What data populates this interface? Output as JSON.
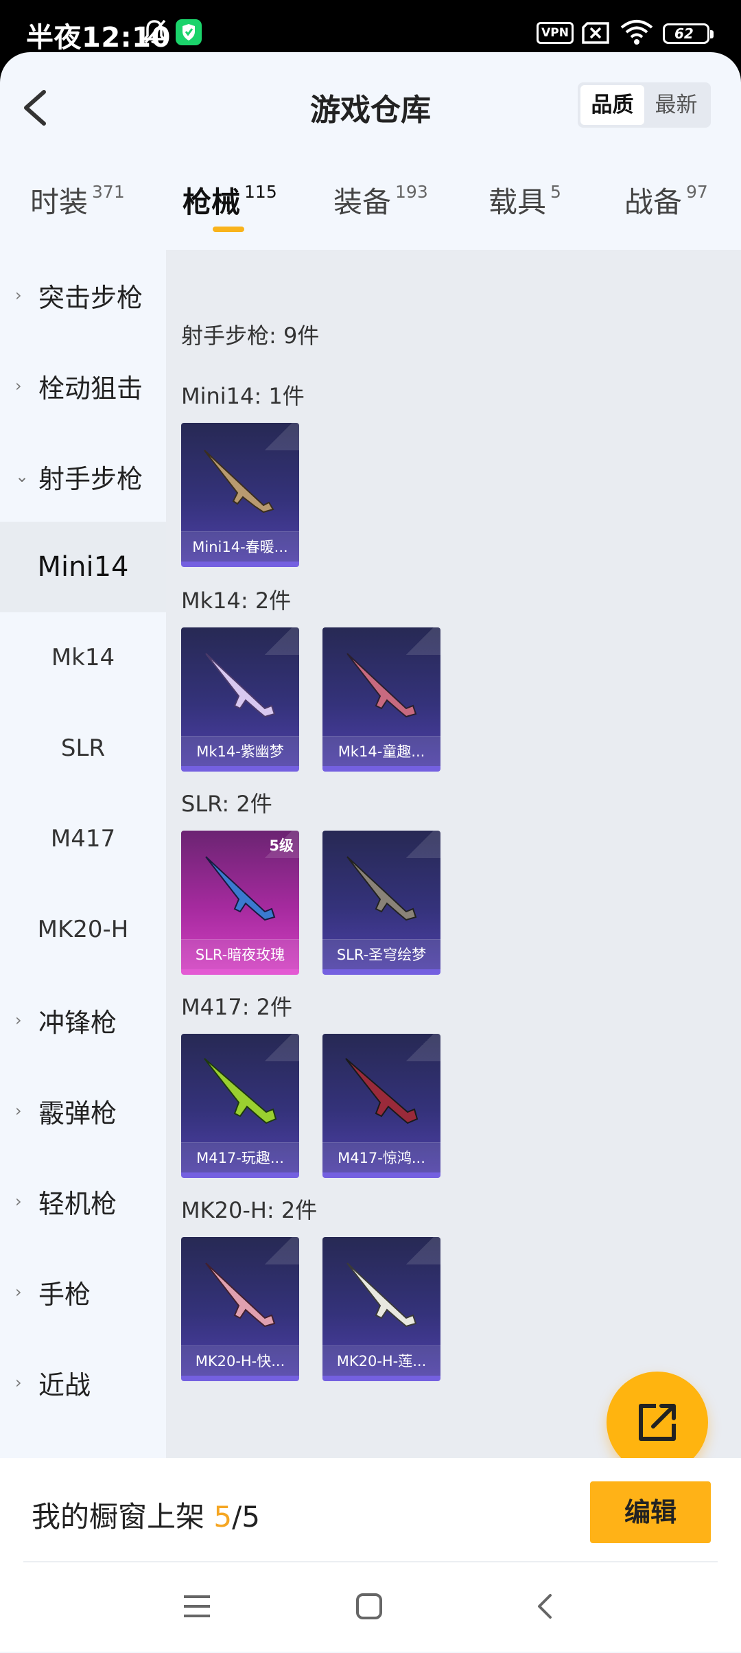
{
  "status_bar": {
    "time": "半夜12:10",
    "vpn": "VPN",
    "battery": "62"
  },
  "header": {
    "title": "游戏仓库",
    "sort_options": [
      "品质",
      "最新"
    ]
  },
  "tabs": [
    {
      "label": "时装",
      "count": "371"
    },
    {
      "label": "枪械",
      "count": "115"
    },
    {
      "label": "装备",
      "count": "193"
    },
    {
      "label": "载具",
      "count": "5"
    },
    {
      "label": "战备",
      "count": "97"
    }
  ],
  "sidebar": [
    {
      "label": "突击步枪"
    },
    {
      "label": "栓动狙击"
    },
    {
      "label": "射手步枪"
    },
    {
      "label": "Mini14"
    },
    {
      "label": "Mk14"
    },
    {
      "label": "SLR"
    },
    {
      "label": "M417"
    },
    {
      "label": "MK20-H"
    },
    {
      "label": "冲锋枪"
    },
    {
      "label": "霰弹枪"
    },
    {
      "label": "轻机枪"
    },
    {
      "label": "手枪"
    },
    {
      "label": "近战"
    }
  ],
  "content": {
    "category_title": "射手步枪: 9件",
    "groups": [
      {
        "title": "Mini14: 1件",
        "items": [
          {
            "name": "Mini14-春暖..."
          }
        ]
      },
      {
        "title": "Mk14: 2件",
        "items": [
          {
            "name": "Mk14-紫幽梦"
          },
          {
            "name": "Mk14-童趣..."
          }
        ]
      },
      {
        "title": "SLR: 2件",
        "items": [
          {
            "name": "SLR-暗夜玫瑰",
            "level": "5级"
          },
          {
            "name": "SLR-圣穹绘梦"
          }
        ]
      },
      {
        "title": "M417: 2件",
        "items": [
          {
            "name": "M417-玩趣..."
          },
          {
            "name": "M417-惊鸿..."
          }
        ]
      },
      {
        "title": "MK20-H: 2件",
        "items": [
          {
            "name": "MK20-H-快..."
          },
          {
            "name": "MK20-H-莲..."
          }
        ]
      }
    ]
  },
  "bottom": {
    "shelf_label": "我的橱窗上架",
    "shelf_current": "5",
    "shelf_total": "/5",
    "edit_label": "编辑"
  },
  "icons": {
    "back": "chevron-left-icon",
    "fab": "share-icon",
    "nav": [
      "menu-icon",
      "home-icon",
      "back-icon"
    ]
  },
  "colors": {
    "accent": "#ffb217",
    "card_blue": "#34327a",
    "card_pink": "#c43bb8"
  }
}
